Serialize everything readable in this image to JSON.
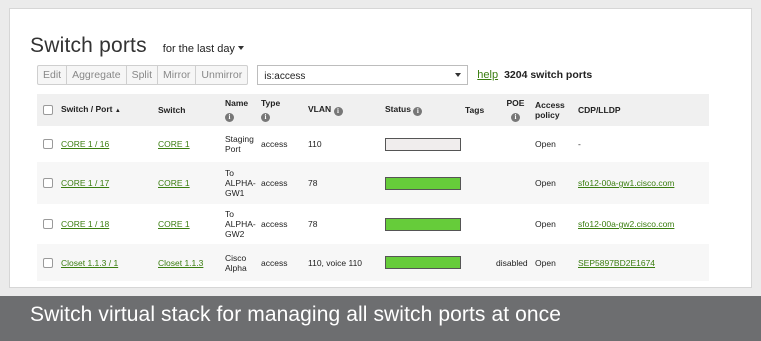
{
  "header": {
    "title": "Switch ports",
    "period_label": "for the last day"
  },
  "toolbar": {
    "buttons": [
      "Edit",
      "Aggregate",
      "Split",
      "Mirror",
      "Unmirror"
    ],
    "search_value": "is:access",
    "help_label": "help",
    "count_text": "3204 switch ports"
  },
  "table": {
    "headers": {
      "switch_port": "Switch / Port",
      "switch_port_sort": "▲",
      "switch": "Switch",
      "name": "Name",
      "type": "Type",
      "vlan": "VLAN",
      "status": "Status",
      "tags": "Tags",
      "poe": "POE",
      "access_policy_1": "Access",
      "access_policy_2": "policy",
      "cdp": "CDP/LLDP"
    },
    "rows": [
      {
        "port": "CORE 1 / 16",
        "switch": "CORE 1",
        "name": [
          "Staging",
          "Port"
        ],
        "type": "access",
        "vlan": "110",
        "status_fill": 0.0,
        "tags": "",
        "poe": "",
        "policy": "Open",
        "cdp": "-"
      },
      {
        "port": "CORE 1 / 17",
        "switch": "CORE 1",
        "name": [
          "To",
          "ALPHA-",
          "GW1"
        ],
        "type": "access",
        "vlan": "78",
        "status_fill": 1.0,
        "tags": "",
        "poe": "",
        "policy": "Open",
        "cdp": "sfo12-00a-gw1.cisco.com"
      },
      {
        "port": "CORE 1 / 18",
        "switch": "CORE 1",
        "name": [
          "To",
          "ALPHA-",
          "GW2"
        ],
        "type": "access",
        "vlan": "78",
        "status_fill": 1.0,
        "tags": "",
        "poe": "",
        "policy": "Open",
        "cdp": "sfo12-00a-gw2.cisco.com"
      },
      {
        "port": "Closet 1.1.3 / 1",
        "switch": "Closet 1.1.3",
        "name": [
          "Cisco",
          "Alpha"
        ],
        "type": "access",
        "vlan": "110, voice 110",
        "status_fill": 1.0,
        "tags": "",
        "poe": "disabled",
        "policy": "Open",
        "cdp": "SEP5897BD2E1674"
      }
    ]
  },
  "caption": "Switch virtual stack for managing all switch ports at once",
  "colors": {
    "link": "#3a7d0f",
    "status_ok": "#66cc3a",
    "status_empty": "#f0eded",
    "caption_bg": "#6d6e70"
  }
}
